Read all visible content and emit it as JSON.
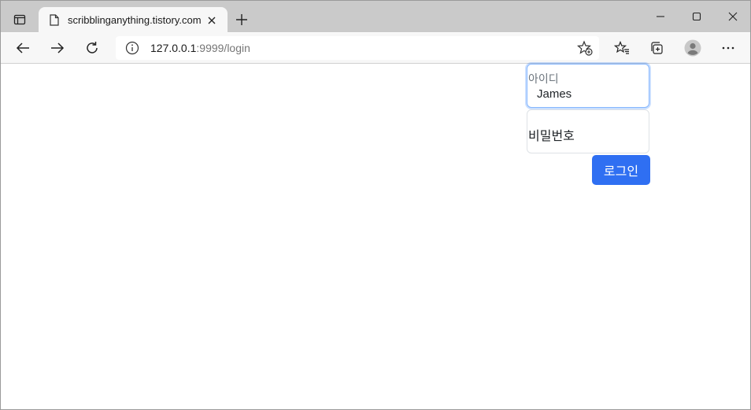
{
  "browser": {
    "tab": {
      "title": "scribblinganything.tistory.com"
    },
    "address_bar": {
      "host": "127.0.0.1",
      "path": ":9999/login"
    }
  },
  "icons": {
    "tab_actions": "tab-actions-icon",
    "favicon": "page-icon",
    "tab_close": "close-icon",
    "new_tab": "plus-icon",
    "minimize": "minimize-icon",
    "maximize": "maximize-icon",
    "close_window": "close-icon",
    "back": "back-arrow-icon",
    "forward": "forward-arrow-icon",
    "refresh": "refresh-icon",
    "site_info": "info-icon",
    "add_favorite": "star-plus-icon",
    "favorites": "favorites-icon",
    "collections": "collections-icon",
    "profile": "profile-icon",
    "more": "more-icon"
  },
  "login_form": {
    "username": {
      "label": "아이디",
      "value": "James"
    },
    "password": {
      "placeholder": "비밀번호",
      "value": ""
    },
    "submit_label": "로그인"
  },
  "colors": {
    "primary": "#2f6ff2",
    "focus_border": "#86b7fe"
  }
}
